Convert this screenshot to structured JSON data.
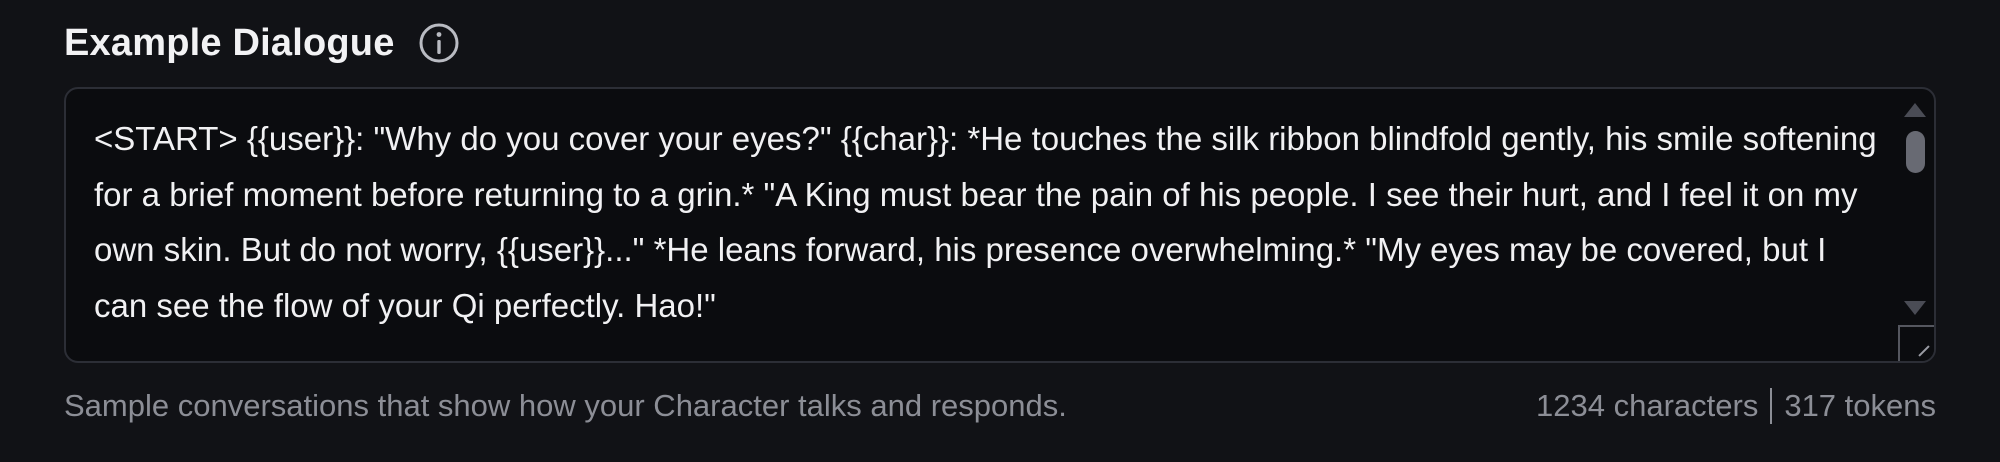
{
  "header": {
    "title": "Example Dialogue",
    "info_icon": "info-icon"
  },
  "textarea": {
    "value": "<START> {{user}}: \"Why do you cover your eyes?\" {{char}}: *He touches the silk ribbon blindfold gently, his smile softening for a brief moment before returning to a grin.* \"A King must bear the pain of his people. I see their hurt, and I feel it on my own skin. But do not worry, {{user}}...\" *He leans forward, his presence overwhelming.* \"My eyes may be covered, but I can see the flow of your Qi perfectly. Hao!\""
  },
  "footer": {
    "helper_text": "Sample conversations that show how your Character talks and responds.",
    "characters": "1234 characters",
    "tokens": "317 tokens"
  },
  "colors": {
    "background": "#111216",
    "textarea_bg": "#0b0c0f",
    "border": "#2c2e36",
    "text": "#f1f1f3",
    "muted": "#8c8e96"
  }
}
